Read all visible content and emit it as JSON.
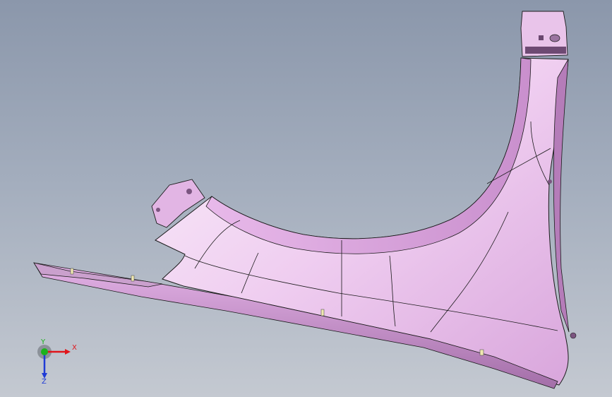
{
  "axis_triad": {
    "x_label": "X",
    "y_label": "Y",
    "z_label": "Z",
    "x_color": "#e0151b",
    "y_color": "#1bb21b",
    "z_color": "#1f3bd6"
  },
  "model": {
    "description_icon": "fender-part",
    "surface_color": "#f1d4f2",
    "shade_color": "#cc96cf",
    "edge_color": "#1a1a1a"
  }
}
